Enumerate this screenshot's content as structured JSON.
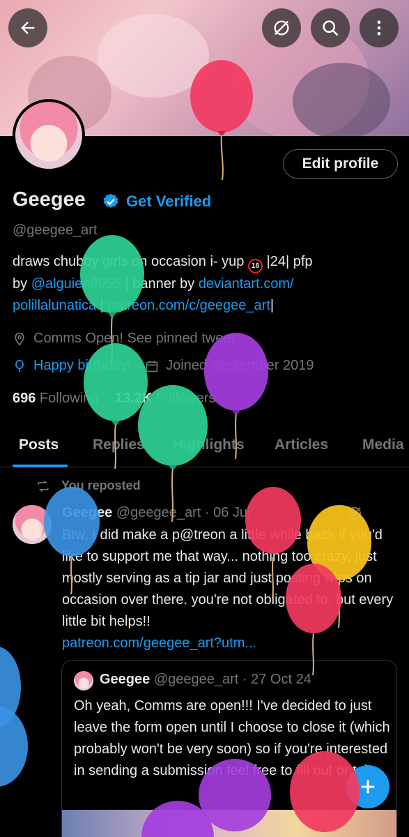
{
  "profile": {
    "name": "Geegee",
    "get_verified": "Get Verified",
    "handle": "@geegee_art",
    "edit_profile": "Edit profile",
    "bio_1": "draws chubby girls on occasion i- yup ",
    "bio_adult": "18",
    "bio_2": " |24| pfp",
    "bio_by": "by ",
    "bio_mention": "@alguien9955",
    "bio_banner": " | banner by ",
    "bio_link1": "deviantart.com/",
    "bio_link1b": "polillalunatica",
    "bio_sep": " | ",
    "bio_link2": "patreon.com/c/geegee_art",
    "bio_end": "|",
    "location": "Comms Open! See pinned tweet",
    "birthday": "Happy birthday!",
    "joined": "Joined September 2019",
    "following_count": "696",
    "following_label": " Following",
    "followers_count": "13.2K",
    "followers_label": " Followers"
  },
  "tabs": [
    "Posts",
    "Replies",
    "Highlights",
    "Articles",
    "Media"
  ],
  "tweet": {
    "repost_label": "You reposted",
    "author": "Geegee",
    "handle_date": " @geegee_art · 06 Jul",
    "body": "Btw, I did make a p@treon a little while back if you'd like to support me that way... nothing too crazy, just mostly serving as a tip jar and just posting wips on occasion over there. you're not obligated to, but every little bit helps!!",
    "link": "patreon.com/geegee_art?utm..."
  },
  "quote": {
    "author": "Geegee",
    "handle_date": " @geegee_art · 27 Oct 24",
    "body": "Oh yeah, Comms are open!!! I've decided to just leave the form open until I choose to close it (which probably won't be very soon) so if you're interested in sending a submission feel free to fill out or take"
  },
  "colors": {
    "accent": "#1d9bf0",
    "background": "#000000",
    "text": "#e7e9ea",
    "muted": "#71767b"
  },
  "icons": [
    "back-arrow-icon",
    "grok-slash-icon",
    "search-icon",
    "more-vertical-icon",
    "verified-badge-icon",
    "location-icon",
    "balloon-icon",
    "calendar-icon",
    "repost-icon",
    "compose-plus-icon"
  ]
}
